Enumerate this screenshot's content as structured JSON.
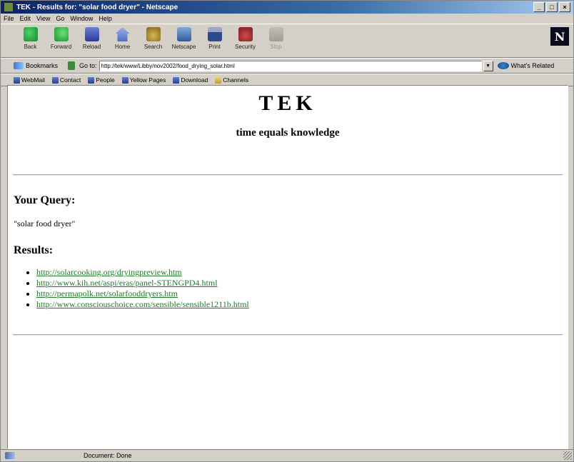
{
  "window": {
    "title": "TEK - Results for: \"solar food dryer\" - Netscape",
    "controls": [
      "_",
      "□",
      "×"
    ]
  },
  "menu": [
    "File",
    "Edit",
    "View",
    "Go",
    "Window",
    "Help"
  ],
  "nav_buttons": [
    {
      "label": "Back",
      "icon": "back-arrow-icon"
    },
    {
      "label": "Forward",
      "icon": "forward-arrow-icon"
    },
    {
      "label": "Reload",
      "icon": "reload-icon"
    },
    {
      "label": "Home",
      "icon": "home-icon"
    },
    {
      "label": "Search",
      "icon": "search-icon"
    },
    {
      "label": "Netscape",
      "icon": "netscape-icon"
    },
    {
      "label": "Print",
      "icon": "print-icon"
    },
    {
      "label": "Security",
      "icon": "lock-icon"
    },
    {
      "label": "Stop",
      "icon": "stop-icon",
      "disabled": true
    }
  ],
  "location": {
    "bookmarks_label": "Bookmarks",
    "goto_label": "Go to:",
    "url": "http://tek/www/Libby/nov2002/food_drying_solar.html",
    "related_label": "What's Related"
  },
  "personal_toolbar": [
    {
      "label": "WebMail",
      "icon": "bookmark-icon"
    },
    {
      "label": "Contact",
      "icon": "bookmark-icon"
    },
    {
      "label": "People",
      "icon": "bookmark-icon"
    },
    {
      "label": "Yellow Pages",
      "icon": "bookmark-icon"
    },
    {
      "label": "Download",
      "icon": "bookmark-icon"
    },
    {
      "label": "Channels",
      "icon": "folder-icon"
    }
  ],
  "page": {
    "title": "TEK",
    "tagline": "time equals knowledge",
    "query_heading": "Your Query:",
    "query": "\"solar food dryer\"",
    "results_heading": "Results:",
    "results": [
      "http://solarcooking.org/dryingpreview.htm",
      "http://www.kih.net/aspi/eras/panel-STENGPD4.html",
      "http://permapolk.net/solarfooddryers.htm",
      "http://www.consciouschoice.com/sensible/sensible1211b.html"
    ]
  },
  "status": {
    "text": "Document: Done"
  }
}
